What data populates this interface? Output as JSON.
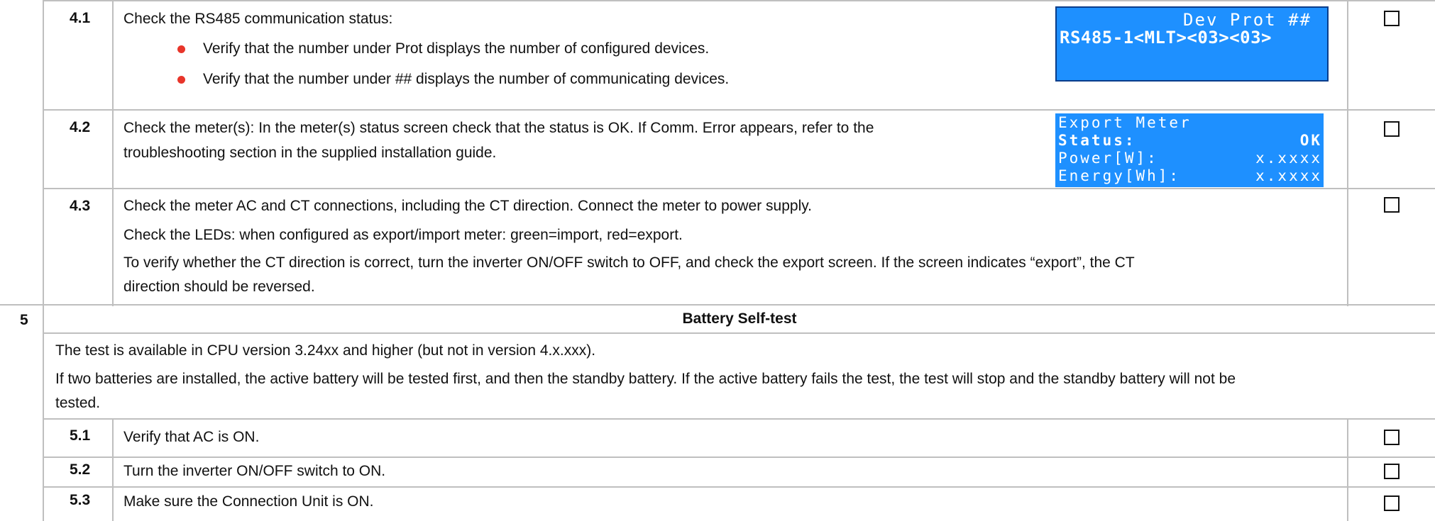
{
  "rows": {
    "r41": {
      "num": "4.1",
      "title": "Check the RS485 communication status:",
      "bullets": [
        "Verify that the number under Prot displays the number of configured devices.",
        "Verify that the number under ## displays the number of communicating devices."
      ],
      "lcd": {
        "line1": "Dev Prot ##",
        "line2": "RS485-1<MLT><03><03>"
      }
    },
    "r42": {
      "num": "4.2",
      "text1": "Check the meter(s): In the meter(s) status screen check that the status is OK. If Comm. Error appears, refer to the",
      "text2": "troubleshooting section in the supplied installation guide.",
      "lcd": {
        "line1": "Export Meter",
        "status_label": "Status:",
        "status_value": "OK",
        "power_label": "Power[W]:",
        "power_value": "x.xxxx",
        "energy_label": "Energy[Wh]:",
        "energy_value": "x.xxxx"
      }
    },
    "r43": {
      "num": "4.3",
      "p1": "Check the meter AC and CT connections, including the CT direction.  Connect the meter to power supply.",
      "p2": "Check the LEDs: when configured as export/import meter: green=import, red=export.",
      "p3a": "To verify whether the CT direction is correct, turn the inverter ON/OFF switch to OFF, and check the export screen. If the screen indicates “export”, the CT",
      "p3b": "direction should be reversed."
    },
    "s5": {
      "num": "5",
      "title": "Battery Self-test",
      "intro1": "The test is available in CPU version 3.24xx and higher (but not in version 4.x.xxx).",
      "intro2a": "If two batteries are installed, the active battery will be tested first, and then the standby battery. If the active battery fails the test, the test will stop and the standby battery will not be",
      "intro2b": "tested."
    },
    "r51": {
      "num": "5.1",
      "text": "Verify that AC is ON."
    },
    "r52": {
      "num": "5.2",
      "text": "Turn the inverter ON/OFF switch to ON."
    },
    "r53": {
      "num": "5.3",
      "text": "Make sure the Connection Unit is ON."
    }
  },
  "colors": {
    "grid": "#bfbfbf",
    "lcd_bg": "#1e90ff",
    "bullet": "#e8352a"
  }
}
